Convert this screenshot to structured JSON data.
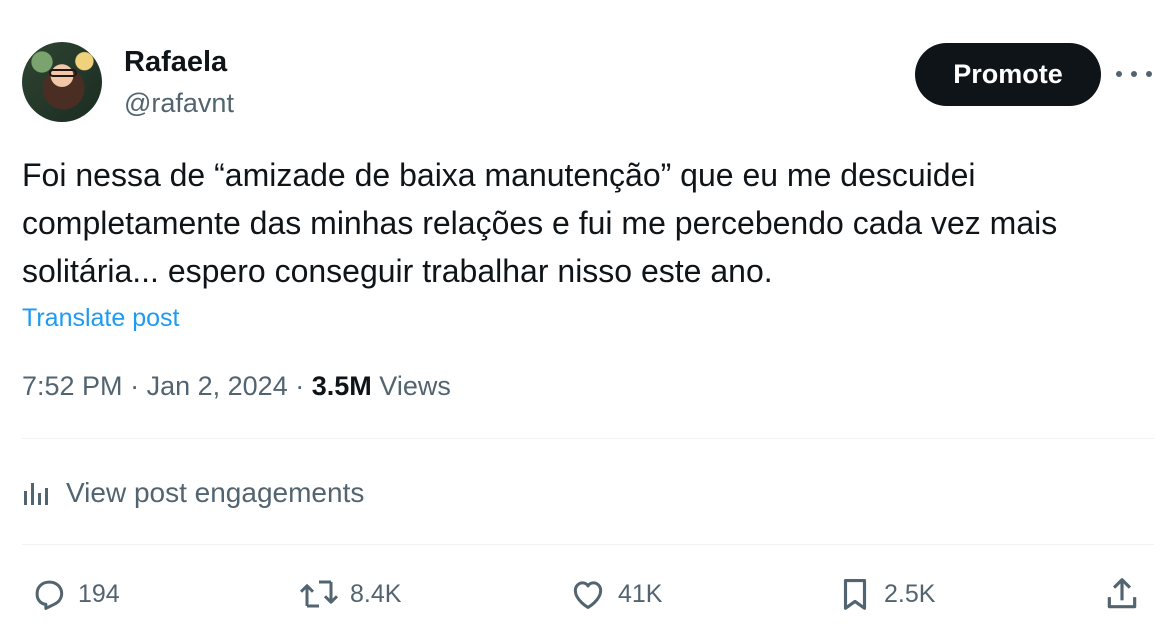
{
  "author": {
    "name": "Rafaela",
    "handle": "@rafavnt",
    "avatar_icon": "profile-photo"
  },
  "header": {
    "promote_label": "Promote",
    "more_icon": "more-horizontal-icon"
  },
  "post": {
    "text": "Foi nessa de “amizade de baixa manutenção” que eu me descuidei\ncompletamente das minhas relações e fui me percebendo cada vez mais\nsolitária... espero conseguir trabalhar nisso este ano.",
    "translate_label": "Translate post"
  },
  "meta": {
    "time": "7:52 PM",
    "separator": "·",
    "date": "Jan 2, 2024",
    "views_count": "3.5M",
    "views_label": "Views"
  },
  "engagements": {
    "label": "View post engagements",
    "icon": "analytics-icon"
  },
  "actions": {
    "replies": "194",
    "reposts": "8.4K",
    "likes": "41K",
    "bookmarks": "2.5K"
  },
  "colors": {
    "text_primary": "#0f1419",
    "text_secondary": "#536471",
    "link": "#1d9bf0",
    "divider": "#eff3f4",
    "button_bg": "#0f1419"
  }
}
